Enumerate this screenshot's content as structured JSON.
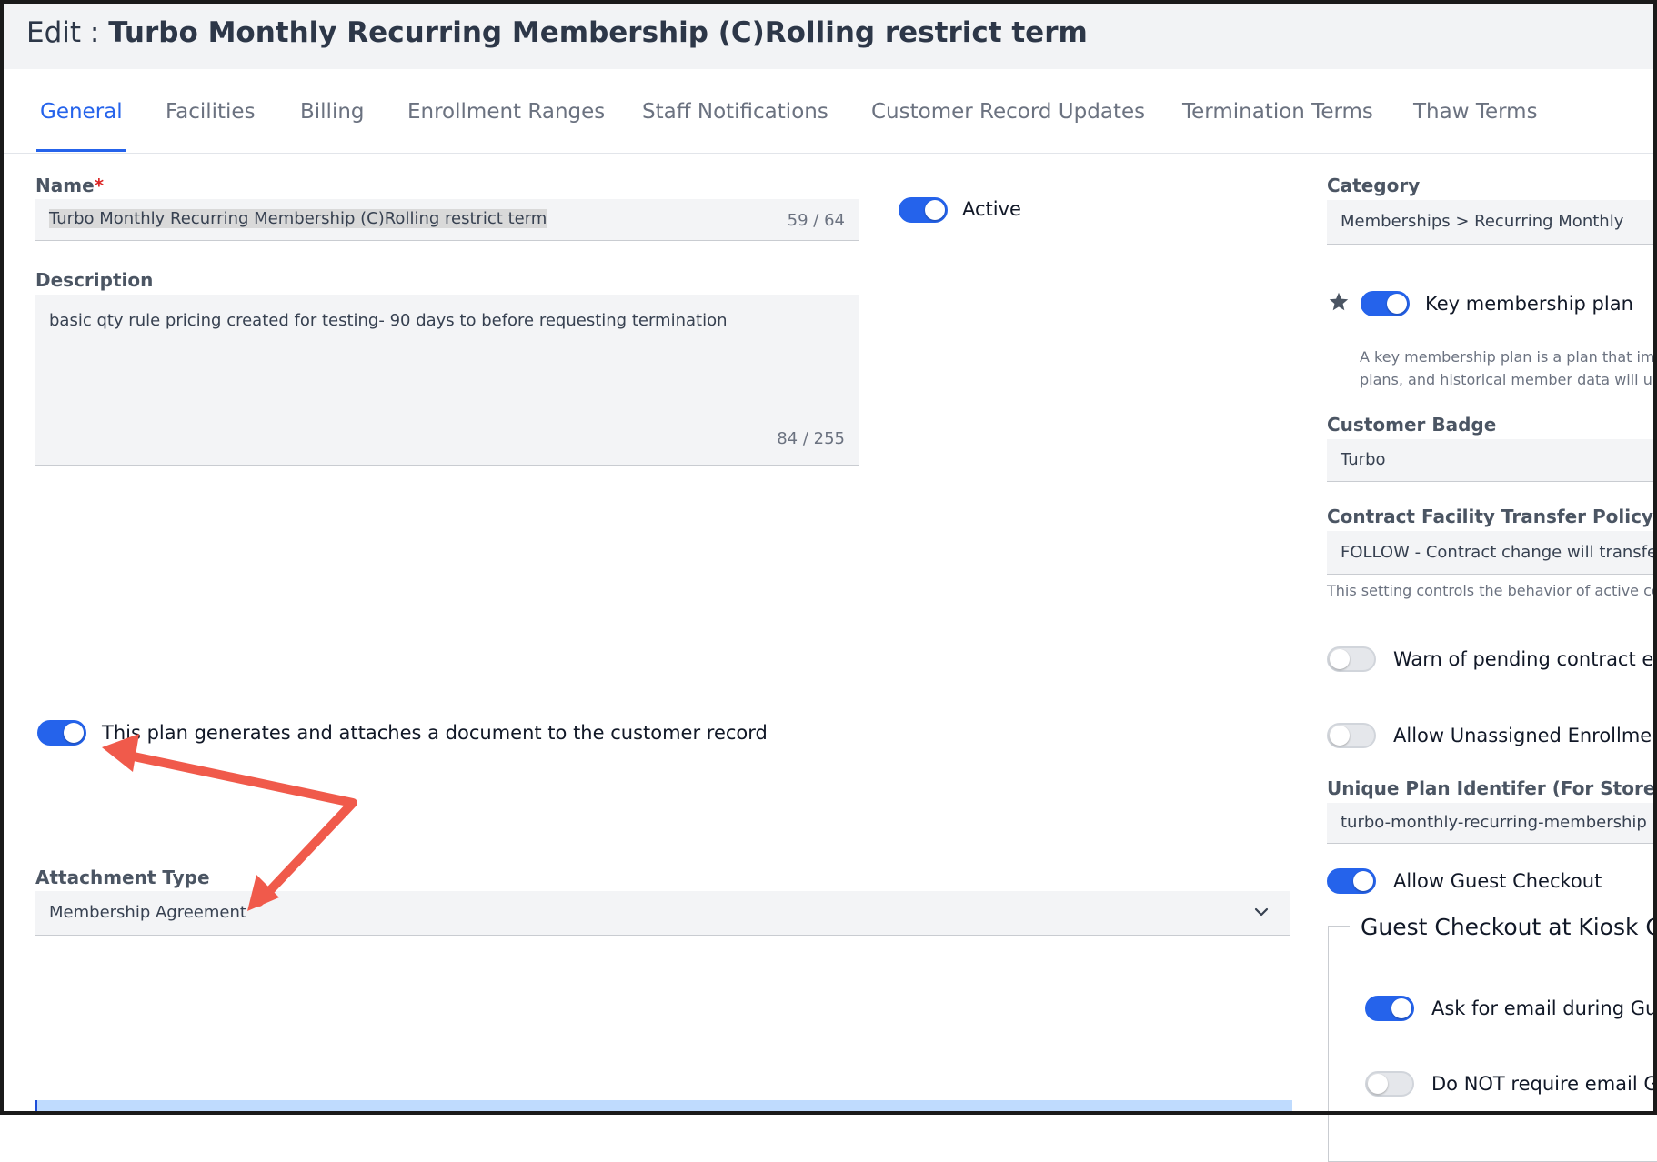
{
  "header": {
    "prefix": "Edit : ",
    "title": "Turbo Monthly Recurring Membership (C)Rolling restrict term"
  },
  "tabs": [
    {
      "label": "General",
      "active": true
    },
    {
      "label": "Facilities"
    },
    {
      "label": "Billing"
    },
    {
      "label": "Enrollment Ranges"
    },
    {
      "label": "Staff Notifications"
    },
    {
      "label": "Customer Record Updates"
    },
    {
      "label": "Termination Terms"
    },
    {
      "label": "Thaw Terms"
    }
  ],
  "form": {
    "name_label": "Name",
    "required_mark": "*",
    "name_value": "Turbo Monthly Recurring Membership (C)Rolling restrict term",
    "name_counter": "59 / 64",
    "active_label": "Active",
    "active_on": true,
    "description_label": "Description",
    "description_value": "basic qty rule pricing created for testing- 90 days to before requesting termination",
    "description_counter": "84 / 255",
    "document_toggle_label": "This plan generates and attaches a document to the customer record",
    "document_toggle_on": true,
    "attachment_type_label": "Attachment Type",
    "attachment_type_value": "Membership Agreement"
  },
  "sidebar": {
    "category_label": "Category",
    "category_value": "Memberships > Recurring Monthly",
    "key_plan_label": "Key membership plan",
    "key_plan_on": true,
    "key_plan_help_line1": "A key membership plan is a plan that imp",
    "key_plan_help_line2": "plans, and historical member data will up",
    "customer_badge_label": "Customer Badge",
    "customer_badge_value": "Turbo",
    "transfer_policy_label": "Contract Facility Transfer Policy",
    "transfer_policy_value": "FOLLOW - Contract change will transfer",
    "transfer_policy_help": "This setting controls the behavior of active co",
    "warn_pending_label": "Warn of pending contract end",
    "warn_pending_on": false,
    "allow_unassigned_label": "Allow Unassigned Enrollment",
    "allow_unassigned_on": false,
    "unique_id_label": "Unique Plan Identifer (For Storefron",
    "unique_id_value": "turbo-monthly-recurring-membership",
    "guest_checkout_label": "Allow Guest Checkout",
    "guest_checkout_on": true,
    "kiosk_legend": "Guest Checkout at Kiosk Op",
    "ask_email_label": "Ask for email during Gue",
    "ask_email_on": true,
    "no_email_label": "Do NOT require email Gu",
    "no_email_on": false
  },
  "icons": {
    "star": "star-icon",
    "chevron": "chevron-down-icon"
  },
  "colors": {
    "accent": "#2563eb",
    "annotation_arrow": "#f05a4b",
    "required": "#dc2626"
  }
}
